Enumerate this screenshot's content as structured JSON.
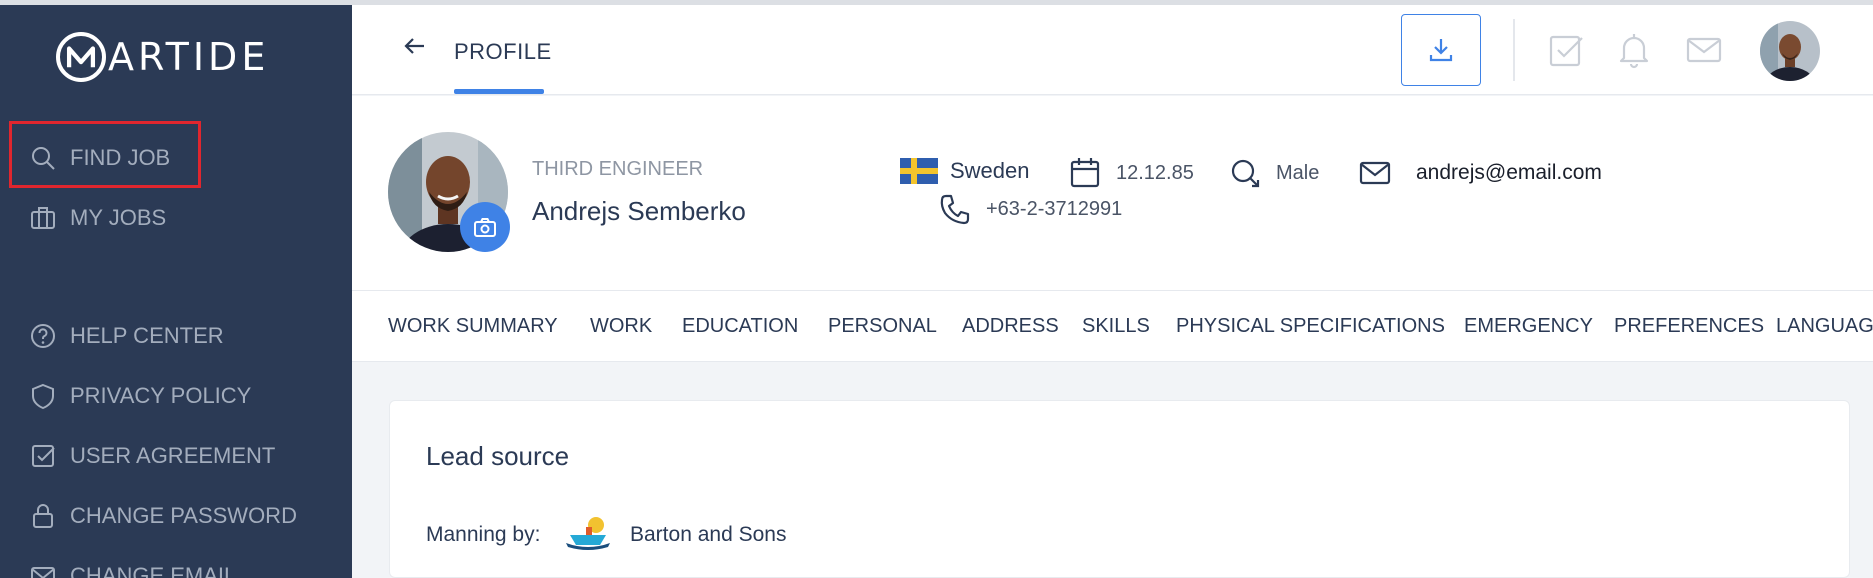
{
  "app": {
    "logo_text": "ARTIDE",
    "logo_letter": "M"
  },
  "sidebar": {
    "items": [
      {
        "label": "FIND JOB",
        "icon": "search-icon"
      },
      {
        "label": "MY JOBS",
        "icon": "briefcase-icon"
      },
      {
        "label": "HELP CENTER",
        "icon": "question-circle-icon"
      },
      {
        "label": "PRIVACY POLICY",
        "icon": "shield-icon"
      },
      {
        "label": "USER AGREEMENT",
        "icon": "checkbox-icon"
      },
      {
        "label": "CHANGE PASSWORD",
        "icon": "lock-icon"
      },
      {
        "label": "CHANGE EMAIL",
        "icon": "mail-icon"
      }
    ]
  },
  "header": {
    "tab": "PROFILE",
    "icons": [
      "back-arrow-icon",
      "download-icon",
      "checklist-icon",
      "bell-icon",
      "mail-icon",
      "avatar"
    ],
    "accent": "#3f82e6"
  },
  "profile": {
    "role": "THIRD ENGINEER",
    "name": "Andrejs Semberko",
    "country": "Sweden",
    "birth_date": "12.12.85",
    "gender": "Male",
    "email": "andrejs@email.com",
    "phone": "+63-2-3712991"
  },
  "tabs": [
    "WORK SUMMARY",
    "WORK",
    "EDUCATION",
    "PERSONAL",
    "ADDRESS",
    "SKILLS",
    "PHYSICAL SPECIFICATIONS",
    "EMERGENCY",
    "PREFERENCES",
    "LANGUAG"
  ],
  "lead": {
    "title": "Lead source",
    "manning_label": "Manning by:",
    "company": "Barton and Sons"
  },
  "colors": {
    "sidebar": "#2b3a55",
    "accent": "#3f82e6",
    "highlight": "#e0262e"
  }
}
